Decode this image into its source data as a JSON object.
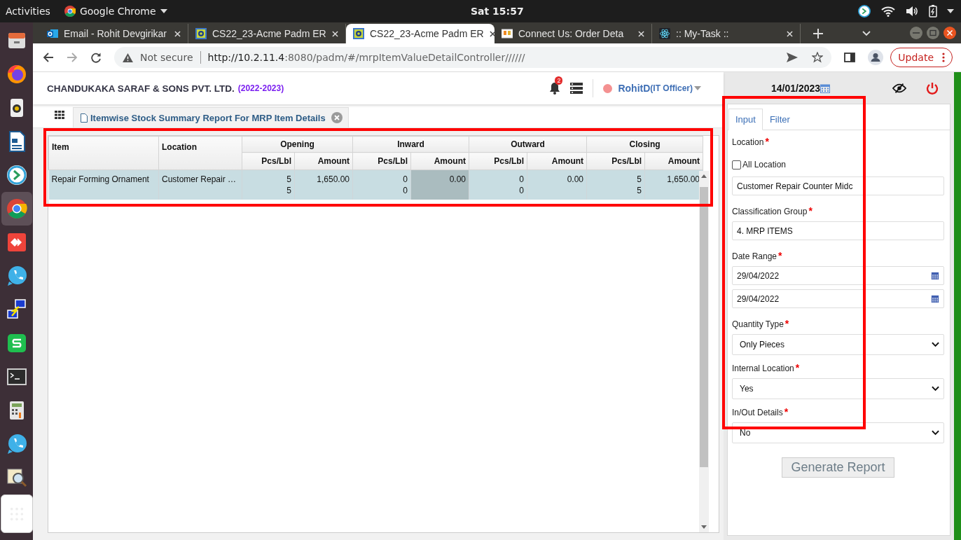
{
  "topbar": {
    "activities": "Activities",
    "app": "Google Chrome",
    "clock": "Sat 15:57"
  },
  "browser": {
    "tabs": [
      {
        "title": "Email - Rohit Devgirikar",
        "selected": false,
        "kind": "mail"
      },
      {
        "title": "CS22_23-Acme Padm ER",
        "selected": false,
        "kind": "erp"
      },
      {
        "title": "CS22_23-Acme Padm ER",
        "selected": true,
        "kind": "erp"
      },
      {
        "title": "Connect Us: Order Deta",
        "selected": false,
        "kind": "shop"
      },
      {
        "title": ":: My-Task ::",
        "selected": false,
        "kind": "react"
      }
    ],
    "security": "Not secure",
    "url_host": "http://10.2.11.4",
    "url_rest": ":8080/padm/#/mrpItemValueDetailController//////",
    "update": "Update"
  },
  "header": {
    "company": "CHANDUKAKA SARAF & SONS PVT. LTD.",
    "year": "(2022-2023)",
    "notifications": "2",
    "user": "RohitD",
    "role": "(IT Officer)",
    "date": "14/01/2023"
  },
  "report_tab": {
    "title": "Itemwise Stock Summary Report For MRP Item Details"
  },
  "table": {
    "item_header": "Item",
    "location_header": "Location",
    "groups": [
      "Opening",
      "Inward",
      "Outward",
      "Closing"
    ],
    "sub_headers": [
      "Pcs/Lbl",
      "Amount",
      "Pcs/Lbl",
      "Amount",
      "Pcs/Lbl",
      "Amount",
      "Pcs/Lbl",
      "Amount"
    ],
    "rows": [
      {
        "item": "Repair Forming Ornament",
        "location": "Customer Repair …",
        "selected": true,
        "cells": [
          {
            "lines": [
              "5",
              "5"
            ],
            "focused": false
          },
          {
            "lines": [
              "1,650.00"
            ],
            "focused": false
          },
          {
            "lines": [
              "0",
              "0"
            ],
            "focused": false
          },
          {
            "lines": [
              "0.00"
            ],
            "focused": true
          },
          {
            "lines": [
              "0",
              "0"
            ],
            "focused": false
          },
          {
            "lines": [
              "0.00"
            ],
            "focused": false
          },
          {
            "lines": [
              "5",
              "5"
            ],
            "focused": false
          },
          {
            "lines": [
              "1,650.00"
            ],
            "focused": false
          }
        ]
      }
    ]
  },
  "form": {
    "tabs": [
      {
        "label": "Input",
        "selected": true
      },
      {
        "label": "Filter",
        "selected": false
      }
    ],
    "fields": [
      {
        "kind": "label",
        "text": "Location",
        "mark": "*"
      },
      {
        "kind": "checkbox",
        "text": "All Location",
        "checked": false
      },
      {
        "kind": "text",
        "value": "Customer Repair Counter Midc"
      },
      {
        "kind": "label",
        "text": "Classification Group",
        "mark": "*"
      },
      {
        "kind": "text",
        "value": "4. MRP ITEMS"
      },
      {
        "kind": "label",
        "text": "Date Range",
        "mark": "*"
      },
      {
        "kind": "date",
        "value": "29/04/2022"
      },
      {
        "kind": "date",
        "value": "29/04/2022"
      },
      {
        "kind": "label",
        "text": "Quantity Type",
        "mark": "*"
      },
      {
        "kind": "select",
        "value": "Only Pieces"
      },
      {
        "kind": "label",
        "text": "Internal Location",
        "mark": "*"
      },
      {
        "kind": "select",
        "value": "Yes"
      },
      {
        "kind": "label",
        "text": "In/Out Details",
        "mark": "*"
      },
      {
        "kind": "select",
        "value": "No"
      }
    ],
    "generate": "Generate Report"
  }
}
